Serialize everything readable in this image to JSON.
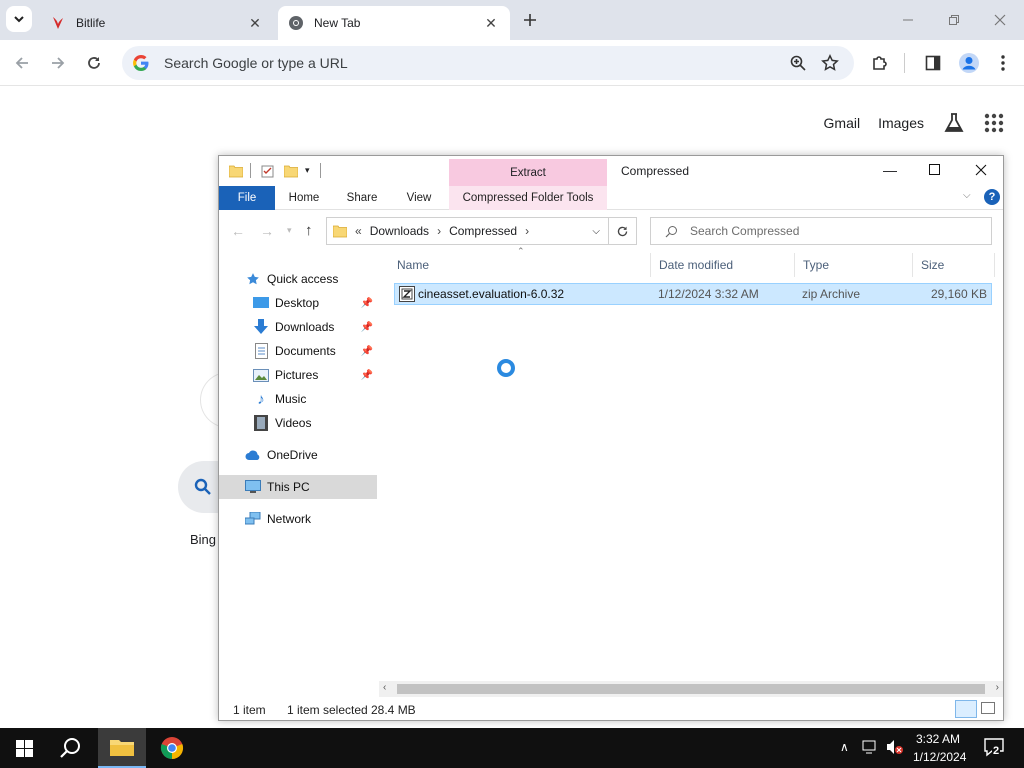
{
  "browser": {
    "tabs": [
      {
        "title": "Bitlife",
        "icon": "bitlife-favicon"
      },
      {
        "title": "New Tab",
        "icon": "chrome-favicon",
        "active": true
      }
    ],
    "omnibox_placeholder": "Search Google or type a URL",
    "ntp_links": {
      "gmail": "Gmail",
      "images": "Images"
    },
    "shortcut_label": "Bing"
  },
  "explorer": {
    "title": "Compressed",
    "context_tab": "Extract",
    "ribbon": {
      "file": "File",
      "home": "Home",
      "share": "Share",
      "view": "View",
      "tools": "Compressed Folder Tools"
    },
    "breadcrumb": {
      "overflow": "«",
      "items": [
        "Downloads",
        "Compressed"
      ]
    },
    "search_placeholder": "Search Compressed",
    "nav": {
      "quick_access": "Quick access",
      "desktop": "Desktop",
      "downloads": "Downloads",
      "documents": "Documents",
      "pictures": "Pictures",
      "music": "Music",
      "videos": "Videos",
      "onedrive": "OneDrive",
      "this_pc": "This PC",
      "network": "Network"
    },
    "columns": {
      "name": "Name",
      "date": "Date modified",
      "type": "Type",
      "size": "Size"
    },
    "files": [
      {
        "name": "cineasset.evaluation-6.0.32",
        "date": "1/12/2024 3:32 AM",
        "type": "zip Archive",
        "size": "29,160 KB",
        "selected": true
      }
    ],
    "status": {
      "count": "1 item",
      "selected": "1 item selected",
      "size": "28.4 MB"
    }
  },
  "taskbar": {
    "time": "3:32 AM",
    "date": "1/12/2024",
    "notifications": "2"
  },
  "colors": {
    "accent": "#1a62b8",
    "selection": "#cce8ff",
    "context_tab": "#f8c9e0"
  }
}
